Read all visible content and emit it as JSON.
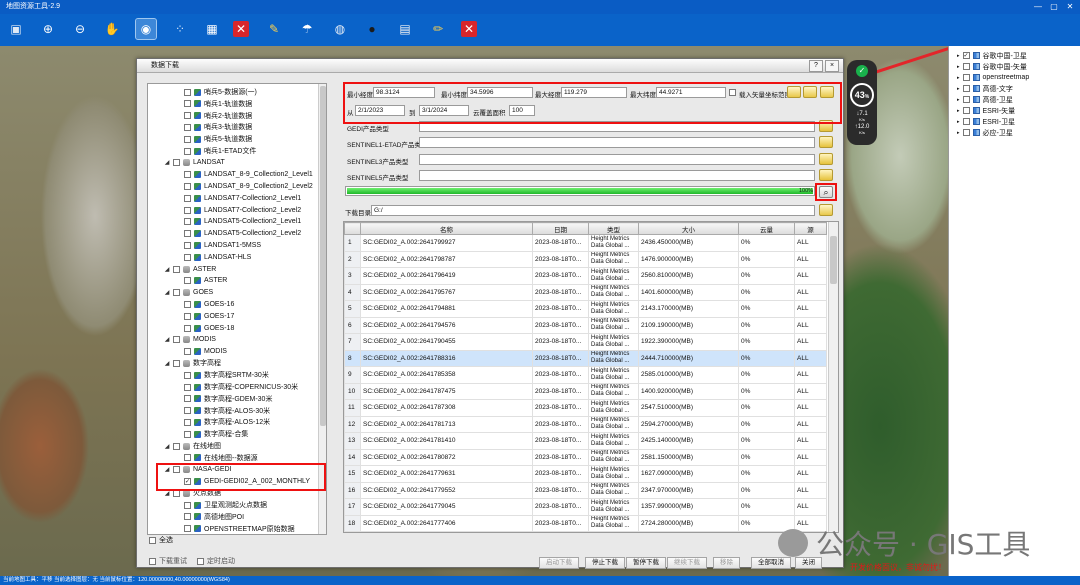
{
  "app": {
    "title": "地图资源工具-2.9"
  },
  "toolbar": {
    "icons": [
      "save-icon",
      "zoom-in-icon",
      "zoom-out-icon",
      "hand-pan-icon",
      "target-select-icon",
      "grid-icon",
      "checker-icon",
      "close-red-icon",
      "wrench-icon",
      "umbrella-icon",
      "globe-icon",
      "user-icon",
      "ruler-icon",
      "notebook-icon",
      "pencil-icon",
      "close-red-icon-2"
    ]
  },
  "hud": {
    "percent": "43",
    "suffix": "%",
    "down": "7.1",
    "up": "12.0",
    "unit": "K/s"
  },
  "layers": [
    {
      "label": "谷歌中国-卫星",
      "checked": true
    },
    {
      "label": "谷歌中国-矢量",
      "checked": false
    },
    {
      "label": "openstreetmap",
      "checked": false
    },
    {
      "label": "高德-文字",
      "checked": false
    },
    {
      "label": "高德-卫星",
      "checked": false
    },
    {
      "label": "ESRI-矢量",
      "checked": false
    },
    {
      "label": "ESRI-卫星",
      "checked": false
    },
    {
      "label": "必应-卫星",
      "checked": false
    }
  ],
  "dialog": {
    "title": "数据下载",
    "help": "?",
    "close": "×",
    "tree": [
      {
        "label": "哨兵5-数据源(一)",
        "level": 2,
        "type": "leaf",
        "checked": false
      },
      {
        "label": "哨兵1-轨道数据",
        "level": 2,
        "type": "leaf",
        "checked": false
      },
      {
        "label": "哨兵2-轨道数据",
        "level": 2,
        "type": "leaf",
        "checked": false
      },
      {
        "label": "哨兵3-轨道数据",
        "level": 2,
        "type": "leaf",
        "checked": false
      },
      {
        "label": "哨兵5-轨道数据",
        "level": 2,
        "type": "leaf",
        "checked": false
      },
      {
        "label": "哨兵1-ETAD文件",
        "level": 2,
        "type": "leaf",
        "checked": false
      },
      {
        "label": "LANDSAT",
        "level": 1,
        "type": "group",
        "checked": false
      },
      {
        "label": "LANDSAT_8-9_Collection2_Level1",
        "level": 2,
        "type": "leaf",
        "checked": false
      },
      {
        "label": "LANDSAT_8-9_Collection2_Level2",
        "level": 2,
        "type": "leaf",
        "checked": false
      },
      {
        "label": "LANDSAT7-Collection2_Level1",
        "level": 2,
        "type": "leaf",
        "checked": false
      },
      {
        "label": "LANDSAT7-Collection2_Level2",
        "level": 2,
        "type": "leaf",
        "checked": false
      },
      {
        "label": "LANDSAT5-Collection2_Level1",
        "level": 2,
        "type": "leaf",
        "checked": false
      },
      {
        "label": "LANDSAT5-Collection2_Level2",
        "level": 2,
        "type": "leaf",
        "checked": false
      },
      {
        "label": "LANDSAT1-5MSS",
        "level": 2,
        "type": "leaf",
        "checked": false
      },
      {
        "label": "LANDSAT-HLS",
        "level": 2,
        "type": "leaf",
        "checked": false
      },
      {
        "label": "ASTER",
        "level": 1,
        "type": "group",
        "checked": false
      },
      {
        "label": "ASTER",
        "level": 2,
        "type": "leaf",
        "checked": false
      },
      {
        "label": "GOES",
        "level": 1,
        "type": "group",
        "checked": false
      },
      {
        "label": "GOES-16",
        "level": 2,
        "type": "leaf",
        "checked": false
      },
      {
        "label": "GOES-17",
        "level": 2,
        "type": "leaf",
        "checked": false
      },
      {
        "label": "GOES-18",
        "level": 2,
        "type": "leaf",
        "checked": false
      },
      {
        "label": "MODIS",
        "level": 1,
        "type": "group",
        "checked": false
      },
      {
        "label": "MODIS",
        "level": 2,
        "type": "leaf",
        "checked": false
      },
      {
        "label": "数字高程",
        "level": 1,
        "type": "group",
        "checked": false
      },
      {
        "label": "数字高程SRTM-30米",
        "level": 2,
        "type": "leaf",
        "checked": false
      },
      {
        "label": "数字高程-COPERNICUS-30米",
        "level": 2,
        "type": "leaf",
        "checked": false
      },
      {
        "label": "数字高程-GDEM-30米",
        "level": 2,
        "type": "leaf",
        "checked": false
      },
      {
        "label": "数字高程-ALOS-30米",
        "level": 2,
        "type": "leaf",
        "checked": false
      },
      {
        "label": "数字高程-ALOS-12米",
        "level": 2,
        "type": "leaf",
        "checked": false
      },
      {
        "label": "数字高程-合集",
        "level": 2,
        "type": "leaf",
        "checked": false
      },
      {
        "label": "在线地图",
        "level": 1,
        "type": "group",
        "checked": false
      },
      {
        "label": "在线地图--数据源",
        "level": 2,
        "type": "leaf",
        "checked": false
      },
      {
        "label": "NASA-GEDI",
        "level": 1,
        "type": "group",
        "checked": false
      },
      {
        "label": "GEDI-GEDI02_A_002_MONTHLY",
        "level": 2,
        "type": "leaf",
        "checked": true
      },
      {
        "label": "火点数据",
        "level": 1,
        "type": "group",
        "checked": false
      },
      {
        "label": "卫星观测起火点数据",
        "level": 2,
        "type": "leaf",
        "checked": false
      },
      {
        "label": "高德地图POI",
        "level": 2,
        "type": "leaf",
        "checked": false
      },
      {
        "label": "OPENSTREETMAP原始数据",
        "level": 2,
        "type": "leaf",
        "checked": false
      }
    ],
    "select_all": "全选",
    "bottom_checks": [
      "下载重试",
      "定时启动"
    ],
    "bounds": {
      "min_lon_label": "最小经度",
      "min_lon": "98.3124",
      "min_lat_label": "最小纬度",
      "min_lat": "34.5996",
      "max_lon_label": "最大经度",
      "max_lon": "119.279",
      "max_lat_label": "最大纬度",
      "max_lat": "44.9271",
      "vector_label": "载入矢量坐标范围"
    },
    "date": {
      "from_label": "从",
      "from": "2/1/2023",
      "to_label": "到",
      "to": "3/1/2024",
      "cloud_label": "云覆盖面积",
      "cloud": "100"
    },
    "product_rows": [
      {
        "label": "GEDI产品类型",
        "value": ""
      },
      {
        "label": "SENTINEL1-ETAD产品类型",
        "value": ""
      },
      {
        "label": "SENTINEL3产品类型",
        "value": ""
      },
      {
        "label": "SENTINEL5产品类型",
        "value": ""
      }
    ],
    "progress": {
      "value": 100,
      "text": "100%"
    },
    "download_dir_label": "下载目录",
    "download_dir": "G:/",
    "columns": [
      "名称",
      "日期",
      "类型",
      "大小",
      "云量",
      "源"
    ],
    "rows": [
      [
        "1",
        "SC:GEDI02_A.002:2641799927",
        "2023-08-18T0...",
        "Height Metrics Data Global ...",
        "2436.450000(MB)",
        "0%",
        "ALL"
      ],
      [
        "2",
        "SC:GEDI02_A.002:2641798787",
        "2023-08-18T0...",
        "Height Metrics Data Global ...",
        "1476.900000(MB)",
        "0%",
        "ALL"
      ],
      [
        "3",
        "SC:GEDI02_A.002:2641796419",
        "2023-08-18T0...",
        "Height Metrics Data Global ...",
        "2560.810000(MB)",
        "0%",
        "ALL"
      ],
      [
        "4",
        "SC:GEDI02_A.002:2641795767",
        "2023-08-18T0...",
        "Height Metrics Data Global ...",
        "1401.600000(MB)",
        "0%",
        "ALL"
      ],
      [
        "5",
        "SC:GEDI02_A.002:2641794881",
        "2023-08-18T0...",
        "Height Metrics Data Global ...",
        "2143.170000(MB)",
        "0%",
        "ALL"
      ],
      [
        "6",
        "SC:GEDI02_A.002:2641794576",
        "2023-08-18T0...",
        "Height Metrics Data Global ...",
        "2109.190000(MB)",
        "0%",
        "ALL"
      ],
      [
        "7",
        "SC:GEDI02_A.002:2641790455",
        "2023-08-18T0...",
        "Height Metrics Data Global ...",
        "1922.390000(MB)",
        "0%",
        "ALL"
      ],
      [
        "8",
        "SC:GEDI02_A.002:2641788316",
        "2023-08-18T0...",
        "Height Metrics Data Global ...",
        "2444.710000(MB)",
        "0%",
        "ALL"
      ],
      [
        "9",
        "SC:GEDI02_A.002:2641785358",
        "2023-08-18T0...",
        "Height Metrics Data Global ...",
        "2585.010000(MB)",
        "0%",
        "ALL"
      ],
      [
        "10",
        "SC:GEDI02_A.002:2641787475",
        "2023-08-18T0...",
        "Height Metrics Data Global ...",
        "1400.920000(MB)",
        "0%",
        "ALL"
      ],
      [
        "11",
        "SC:GEDI02_A.002:2641787308",
        "2023-08-18T0...",
        "Height Metrics Data Global ...",
        "2547.510000(MB)",
        "0%",
        "ALL"
      ],
      [
        "12",
        "SC:GEDI02_A.002:2641781713",
        "2023-08-18T0...",
        "Height Metrics Data Global ...",
        "2594.270000(MB)",
        "0%",
        "ALL"
      ],
      [
        "13",
        "SC:GEDI02_A.002:2641781410",
        "2023-08-18T0...",
        "Height Metrics Data Global ...",
        "2425.140000(MB)",
        "0%",
        "ALL"
      ],
      [
        "14",
        "SC:GEDI02_A.002:2641780872",
        "2023-08-18T0...",
        "Height Metrics Data Global ...",
        "2581.150000(MB)",
        "0%",
        "ALL"
      ],
      [
        "15",
        "SC:GEDI02_A.002:2641779631",
        "2023-08-18T0...",
        "Height Metrics Data Global ...",
        "1627.090000(MB)",
        "0%",
        "ALL"
      ],
      [
        "16",
        "SC:GEDI02_A.002:2641779552",
        "2023-08-18T0...",
        "Height Metrics Data Global ...",
        "2347.970000(MB)",
        "0%",
        "ALL"
      ],
      [
        "17",
        "SC:GEDI02_A.002:2641779045",
        "2023-08-18T0...",
        "Height Metrics Data Global ...",
        "1357.990000(MB)",
        "0%",
        "ALL"
      ],
      [
        "18",
        "SC:GEDI02_A.002:2641777406",
        "2023-08-18T0...",
        "Height Metrics Data Global ...",
        "2724.280000(MB)",
        "0%",
        "ALL"
      ]
    ],
    "selected_row": 7,
    "buttons": [
      {
        "label": "启动下载",
        "enabled": false
      },
      {
        "label": "停止下载",
        "enabled": true
      },
      {
        "label": "暂停下载",
        "enabled": true
      },
      {
        "label": "继续下载",
        "enabled": false
      },
      {
        "label": "移除",
        "enabled": false
      },
      {
        "label": "全部取消",
        "enabled": true
      },
      {
        "label": "关闭",
        "enabled": true
      }
    ]
  },
  "status": {
    "text": "当前地图工具：平移  当前选择图层：无  当前鼠标位置：120.00000000,40.00000000(WGS84)"
  },
  "watermark": {
    "text": "公众号 · GIS工具"
  },
  "red_note": {
    "text": "开发价格面议，非诚勿扰！"
  },
  "colors": {
    "accent": "#0a63c9",
    "highlight": "#e11111",
    "progress": "#2fd63a"
  }
}
